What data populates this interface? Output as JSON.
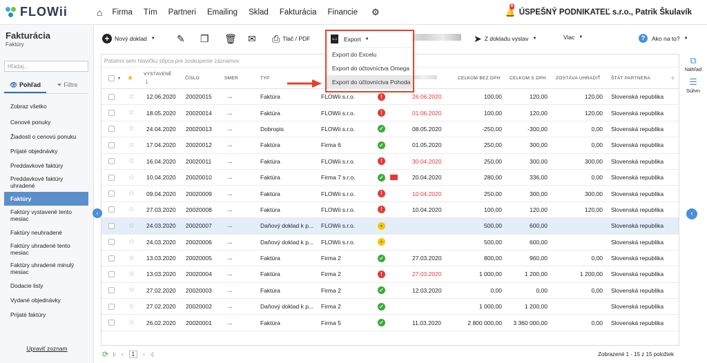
{
  "app": {
    "logo": "FLOWii",
    "company": "ÚSPEŠNÝ PODNIKATEĽ s.r.o., Patrik Škulavík",
    "notifications": "8"
  },
  "nav": [
    "Firma",
    "Tím",
    "Partneri",
    "Emailing",
    "Sklad",
    "Fakturácia",
    "Financie"
  ],
  "sidebar": {
    "title": "Fakturácia",
    "subtitle": "Faktúry",
    "search_placeholder": "Hľadaj...",
    "tab_view": "Pohľad",
    "tab_filter": "Filtre",
    "items": [
      {
        "label": "Zobraz všetko",
        "h": 24
      },
      {
        "label": "Cenové ponuky",
        "h": 21
      },
      {
        "label": "Žiadosti o cenovú ponuku",
        "h": 21
      },
      {
        "label": "Prijaté objednávky",
        "h": 21
      },
      {
        "label": "Preddavkové faktúry",
        "h": 21
      },
      {
        "label": "Preddavkové faktúry uhradené",
        "h": 28
      },
      {
        "label": "Faktúry",
        "h": 20,
        "active": true
      },
      {
        "label": "Faktúry vystavené tento mesiac",
        "h": 28
      },
      {
        "label": "Faktúry neuhradené",
        "h": 21
      },
      {
        "label": "Faktúry uhradené tento mesiac",
        "h": 28
      },
      {
        "label": "Faktúry uhradené minulý mesiac",
        "h": 28
      },
      {
        "label": "Dodacie listy",
        "h": 21
      },
      {
        "label": "Vydané objednávky",
        "h": 21
      },
      {
        "label": "Prijaté faktúry",
        "h": 21
      }
    ],
    "footer": "Upraviť zoznam"
  },
  "toolbar": {
    "new_doc": "Nový doklad",
    "print": "Tlač / PDF",
    "export": "Export",
    "from_doc": "Z dokladu vystav",
    "more": "Viac",
    "help": "Ako na to?"
  },
  "export_menu": [
    "Export do Excelu",
    "Export do účtovníctva Omega",
    "Export do účtovníctva Pohoda"
  ],
  "right_rail": {
    "preview": "Náhľad",
    "summary": "Súhrn"
  },
  "grid": {
    "group_hint": "Potiahni sem hlavičku stĺpca pre zoskupenie záznamov",
    "headers": {
      "issued": "VYSTAVENÉ",
      "number": "ČÍSLO",
      "direction": "SMER",
      "type": "TYP",
      "total_no_vat": "CELKOM BEZ DPH",
      "total_vat": "CELKOM S DPH",
      "remaining": "ZOSTÁVA UHRADIŤ",
      "country": "ŠTÁT PARTNERA"
    },
    "rows": [
      {
        "date": "12.06.2020",
        "num": "20020015",
        "type": "Faktúra",
        "partner": "FLOWii s.r.o.",
        "status": "red",
        "due": "26.06.2020",
        "due_red": true,
        "net": "100,00",
        "gross": "120,00",
        "rem": "120,00",
        "country": "Slovenská republika"
      },
      {
        "date": "18.05.2020",
        "num": "20020014",
        "type": "Faktúra",
        "partner": "FLOWii s.r.o.",
        "status": "red",
        "due": "01.06.2020",
        "due_red": true,
        "net": "100,00",
        "gross": "120,00",
        "rem": "120,00",
        "country": "Slovenská republika"
      },
      {
        "date": "24.04.2020",
        "num": "20020013",
        "type": "Dobropis",
        "partner": "FLOWii s.r.o.",
        "status": "green",
        "due": "08.05.2020",
        "due_red": false,
        "net": "-250,00",
        "gross": "-300,00",
        "rem": "0,00",
        "country": "Slovenská republika"
      },
      {
        "date": "17.04.2020",
        "num": "20020012",
        "type": "Faktúra",
        "partner": "Firma 6",
        "status": "green",
        "due": "01.05.2020",
        "due_red": false,
        "net": "250,00",
        "gross": "300,00",
        "rem": "0,00",
        "country": "Slovenská republika"
      },
      {
        "date": "16.04.2020",
        "num": "20020011",
        "type": "Faktúra",
        "partner": "FLOWii s.r.o.",
        "status": "red",
        "due": "30.04.2020",
        "due_red": true,
        "net": "250,00",
        "gross": "300,00",
        "rem": "300,00",
        "country": "Slovenská republika"
      },
      {
        "date": "10.04.2020",
        "num": "20020010",
        "type": "Faktúra",
        "partner": "Firma 7 s.r.o.",
        "status": "green",
        "mail": true,
        "due": "20.04.2020",
        "due_red": false,
        "net": "280,00",
        "gross": "336,00",
        "rem": "0,00",
        "country": "Slovenská republika"
      },
      {
        "date": "09.04.2020",
        "num": "20020009",
        "type": "Faktúra",
        "partner": "FLOWii s.r.o.",
        "status": "red",
        "due": "10.04.2020",
        "due_red": true,
        "net": "250,00",
        "gross": "300,00",
        "rem": "300,00",
        "country": "Slovenská republika"
      },
      {
        "date": "27.03.2020",
        "num": "20020008",
        "type": "Faktúra",
        "partner": "FLOWii s.r.o.",
        "status": "red",
        "due": "10.04.2020",
        "due_red": false,
        "net": "100,00",
        "gross": "120,00",
        "rem": "120,00",
        "country": "Slovenská republika"
      },
      {
        "date": "24.03.2020",
        "num": "20020007",
        "type": "Daňový doklad k p...",
        "partner": "FLOWii s.r.o.",
        "status": "yellow",
        "due": "",
        "due_red": false,
        "net": "500,00",
        "gross": "600,00",
        "rem": "",
        "country": "Slovenská republika",
        "sel": true
      },
      {
        "date": "24.03.2020",
        "num": "20020006",
        "type": "Daňový doklad k p...",
        "partner": "FLOWii s.r.o.",
        "status": "yellow",
        "due": "",
        "due_red": false,
        "net": "500,00",
        "gross": "600,00",
        "rem": "",
        "country": "Slovenská republika"
      },
      {
        "date": "13.03.2020",
        "num": "20020005",
        "type": "Faktúra",
        "partner": "Firma 2",
        "status": "green",
        "due": "27.03.2020",
        "due_red": false,
        "net": "800,00",
        "gross": "960,00",
        "rem": "0,00",
        "country": "Slovenská republika"
      },
      {
        "date": "13.03.2020",
        "num": "20020004",
        "type": "Faktúra",
        "partner": "Firma 2",
        "status": "red",
        "due": "27.03.2020",
        "due_red": true,
        "net": "1 000,00",
        "gross": "1 200,00",
        "rem": "1 200,00",
        "country": "Slovenská republika"
      },
      {
        "date": "27.02.2020",
        "num": "20020003",
        "type": "Faktúra",
        "partner": "Firma 2",
        "status": "green",
        "due": "12.03.2020",
        "due_red": false,
        "net": "0,00",
        "gross": "0,00",
        "rem": "0,00",
        "country": "Slovenská republika"
      },
      {
        "date": "27.02.2020",
        "num": "20020002",
        "type": "Daňový doklad k p...",
        "partner": "Firma 2",
        "status": "green",
        "due": "",
        "due_red": false,
        "net": "1 000,00",
        "gross": "1 200,00",
        "rem": "",
        "country": "Slovenská republika"
      },
      {
        "date": "26.02.2020",
        "num": "20020001",
        "type": "Faktúra",
        "partner": "Firma 5",
        "status": "green",
        "due": "11.03.2020",
        "due_red": false,
        "net": "2 800 000,00",
        "gross": "3 360 000,00",
        "rem": "0,00",
        "country": "Slovenská republika"
      }
    ]
  },
  "footer": {
    "page": "1",
    "count": "Zobrazené 1 - 15 z 15 položiek"
  }
}
